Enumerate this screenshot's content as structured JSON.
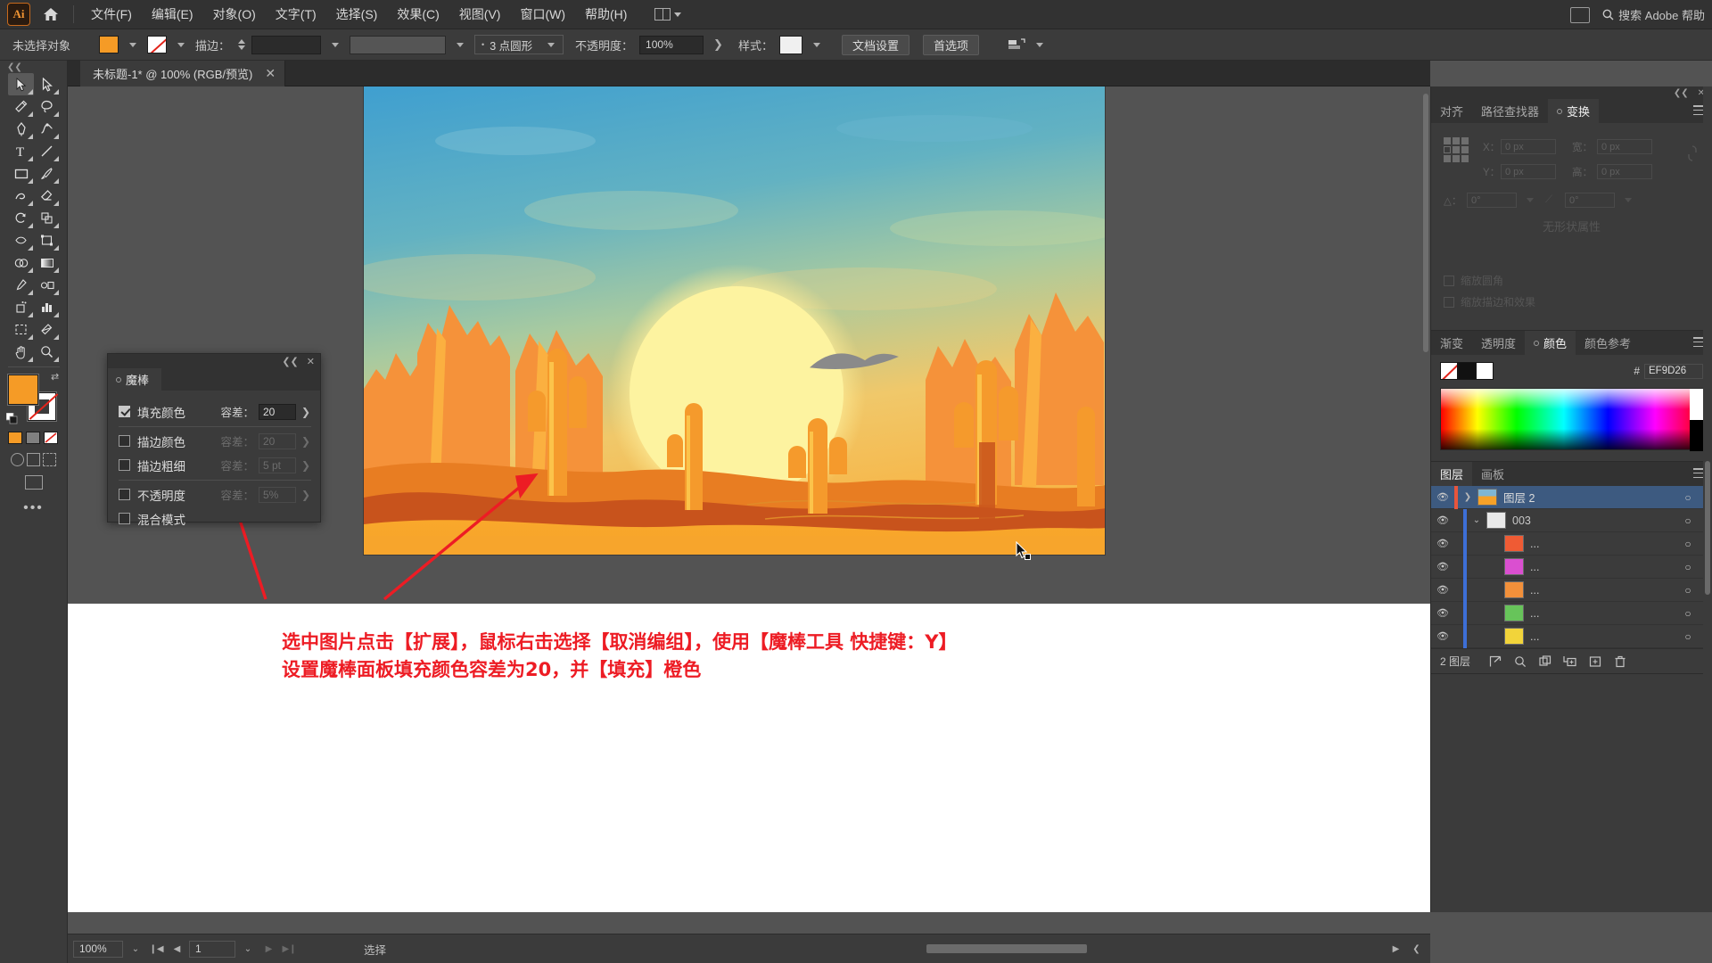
{
  "app": {
    "name": "Adobe Illustrator",
    "logo_text": "Ai"
  },
  "menubar": {
    "items": [
      {
        "label": "文件(F)",
        "name": "menu-file"
      },
      {
        "label": "编辑(E)",
        "name": "menu-edit"
      },
      {
        "label": "对象(O)",
        "name": "menu-object"
      },
      {
        "label": "文字(T)",
        "name": "menu-type"
      },
      {
        "label": "选择(S)",
        "name": "menu-select"
      },
      {
        "label": "效果(C)",
        "name": "menu-effect"
      },
      {
        "label": "视图(V)",
        "name": "menu-view"
      },
      {
        "label": "窗口(W)",
        "name": "menu-window"
      },
      {
        "label": "帮助(H)",
        "name": "menu-help"
      }
    ],
    "search_placeholder": "搜索 Adobe 帮助"
  },
  "controlbar": {
    "selection_status": "未选择对象",
    "fill_color": "#F59B26",
    "stroke_color": "#FFFFFF",
    "stroke_label": "描边：",
    "stroke_width_value": "",
    "brush_profile": "3 点圆形",
    "opacity_label": "不透明度：",
    "opacity_value": "100%",
    "style_label": "样式：",
    "doc_setup_button": "文档设置",
    "preferences_button": "首选项"
  },
  "document_tab": {
    "title": "未标题-1* @ 100% (RGB/预览)",
    "close_label": "✕"
  },
  "toolbar": {
    "tools": [
      {
        "name": "selection-tool",
        "label": "选择工具"
      },
      {
        "name": "direct-selection-tool",
        "label": "直接选择工具"
      },
      {
        "name": "magic-wand-tool",
        "label": "魔棒工具"
      },
      {
        "name": "lasso-tool",
        "label": "套索工具"
      },
      {
        "name": "pen-tool",
        "label": "钢笔工具"
      },
      {
        "name": "curvature-tool",
        "label": "曲率工具"
      },
      {
        "name": "type-tool",
        "label": "文字工具"
      },
      {
        "name": "line-segment-tool",
        "label": "直线段工具"
      },
      {
        "name": "rectangle-tool",
        "label": "矩形工具"
      },
      {
        "name": "paintbrush-tool",
        "label": "画笔工具"
      },
      {
        "name": "shaper-tool",
        "label": "Shaper 工具"
      },
      {
        "name": "eraser-tool",
        "label": "橡皮擦工具"
      },
      {
        "name": "rotate-tool",
        "label": "旋转工具"
      },
      {
        "name": "scale-tool",
        "label": "比例缩放工具"
      },
      {
        "name": "width-tool",
        "label": "宽度工具"
      },
      {
        "name": "free-transform-tool",
        "label": "自由变换工具"
      },
      {
        "name": "shape-builder-tool",
        "label": "形状生成器工具"
      },
      {
        "name": "gradient-tool",
        "label": "渐变工具"
      },
      {
        "name": "eyedropper-tool",
        "label": "吸管工具"
      },
      {
        "name": "blend-tool",
        "label": "混合工具"
      },
      {
        "name": "symbol-sprayer-tool",
        "label": "符号喷枪工具"
      },
      {
        "name": "column-graph-tool",
        "label": "柱形图工具"
      },
      {
        "name": "artboard-tool",
        "label": "画板工具"
      },
      {
        "name": "slice-tool",
        "label": "切片工具"
      },
      {
        "name": "hand-tool",
        "label": "抓手工具"
      },
      {
        "name": "zoom-tool",
        "label": "缩放工具"
      }
    ],
    "fill_color": "#F59B26",
    "stroke_color": "#FFFFFF",
    "more_label": "•••"
  },
  "magic_wand_panel": {
    "tab_label": "魔棒",
    "close_label": "✕",
    "collapse_label": "❮❮",
    "rows": [
      {
        "name": "fill-color",
        "label": "填充颜色",
        "checked": true,
        "tol_label": "容差：",
        "tol_value": "20",
        "enabled": true
      },
      {
        "name": "stroke-color",
        "label": "描边颜色",
        "checked": false,
        "tol_label": "容差：",
        "tol_value": "20",
        "enabled": false
      },
      {
        "name": "stroke-weight",
        "label": "描边粗细",
        "checked": false,
        "tol_label": "容差：",
        "tol_value": "5 pt",
        "enabled": false
      },
      {
        "name": "opacity",
        "label": "不透明度",
        "checked": false,
        "tol_label": "容差：",
        "tol_value": "5%",
        "enabled": false
      },
      {
        "name": "blending-mode",
        "label": "混合模式",
        "checked": false,
        "tol_label": "",
        "tol_value": "",
        "enabled": false
      }
    ]
  },
  "transform_panel": {
    "tabs": [
      {
        "label": "对齐",
        "name": "tab-align",
        "active": false
      },
      {
        "label": "路径查找器",
        "name": "tab-pathfinder",
        "active": false
      },
      {
        "label": "变换",
        "name": "tab-transform",
        "active": true
      }
    ],
    "fields": [
      {
        "label": "X：",
        "value": "0 px",
        "name": "transform-x"
      },
      {
        "label": "宽：",
        "value": "0 px",
        "name": "transform-width"
      },
      {
        "label": "Y：",
        "value": "0 px",
        "name": "transform-y"
      },
      {
        "label": "高：",
        "value": "0 px",
        "name": "transform-height"
      },
      {
        "label": "△：",
        "value": "0°",
        "name": "transform-rotate"
      },
      {
        "label": "",
        "value": "0°",
        "name": "transform-shear"
      }
    ],
    "no_selection_text": "无形状属性",
    "checkbox_scale_corners": "缩放圆角",
    "checkbox_scale_strokes": "缩放描边和效果"
  },
  "color_panel": {
    "tabs": [
      {
        "label": "渐变",
        "name": "tab-gradient",
        "active": false
      },
      {
        "label": "透明度",
        "name": "tab-transparency",
        "active": false
      },
      {
        "label": "颜色",
        "name": "tab-color",
        "active": true
      },
      {
        "label": "颜色参考",
        "name": "tab-color-guide",
        "active": false
      }
    ],
    "hex_prefix": "#",
    "hex_value": "EF9D26"
  },
  "layers_panel": {
    "tabs": [
      {
        "label": "图层",
        "name": "tab-layers",
        "active": true
      },
      {
        "label": "画板",
        "name": "tab-artboards",
        "active": false
      }
    ],
    "rows": [
      {
        "name": "图层 2",
        "indent": 0,
        "active": true,
        "color": "#e8553c",
        "expanded": false,
        "thumb": "artwork",
        "eye": true
      },
      {
        "name": "003",
        "indent": 1,
        "active": false,
        "color": "#3d6fd6",
        "expanded": true,
        "thumb": "group",
        "eye": true
      },
      {
        "name": "...",
        "indent": 2,
        "active": false,
        "color": "#3d6fd6",
        "swatch": "#e8553c",
        "eye": true
      },
      {
        "name": "...",
        "indent": 2,
        "active": false,
        "color": "#3d6fd6",
        "swatch": "#d94fd0",
        "eye": true
      },
      {
        "name": "...",
        "indent": 2,
        "active": false,
        "color": "#3d6fd6",
        "swatch": "#f2903a",
        "eye": true
      },
      {
        "name": "...",
        "indent": 2,
        "active": false,
        "color": "#3d6fd6",
        "swatch": "#67c45a",
        "eye": true
      },
      {
        "name": "...",
        "indent": 2,
        "active": false,
        "color": "#3d6fd6",
        "swatch": "#f2d43a",
        "eye": true
      }
    ],
    "footer_count": "2 图层",
    "footer_icons": [
      "locate-object-icon",
      "search-icon",
      "make-clipping-mask-icon",
      "create-sublayer-icon",
      "new-layer-icon",
      "delete-layer-icon"
    ]
  },
  "statusbar": {
    "zoom_value": "100%",
    "page_value": "1",
    "status_text": "选择"
  },
  "annotation": {
    "line1": "选中图片点击【扩展】，鼠标右击选择【取消编组】，使用【魔棒工具 快捷键：Y】",
    "line2": "设置魔棒面板填充颜色容差为20，并【填充】橙色",
    "color": "#ED1C24"
  },
  "artwork": {
    "title": "沙漠日落仙人掌插画",
    "sky_top": "#4aa3cd",
    "sky_mid": "#9fc9a8",
    "sun": "#fdf3a8",
    "sand": "#f6a128",
    "rock_dark": "#c0491a"
  }
}
